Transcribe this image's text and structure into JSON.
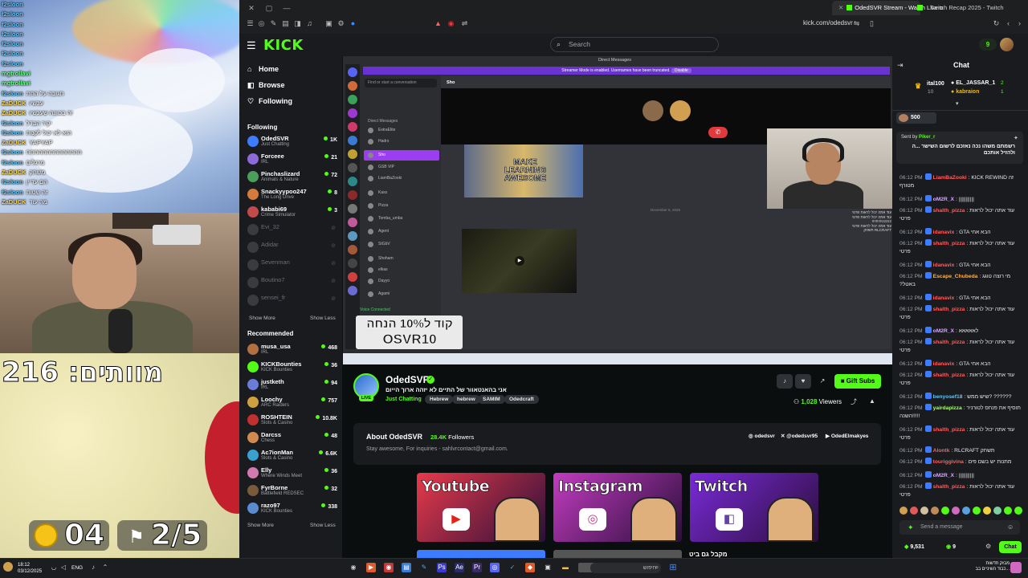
{
  "browser": {
    "tabs": [
      {
        "label": "OdedSVR Stream - Watch Live o"
      },
      {
        "label": "Twitch Recap 2025 - Twitch"
      }
    ],
    "url": "kick.com/odedsvr"
  },
  "overlay_chat": [
    {
      "user": "f2sloon",
      "color": "#59c8ff",
      "text": ""
    },
    {
      "user": "f2sloon",
      "color": "#59c8ff",
      "text": ""
    },
    {
      "user": "f2sloon",
      "color": "#59c8ff",
      "text": ""
    },
    {
      "user": "f2sloon",
      "color": "#59c8ff",
      "text": ""
    },
    {
      "user": "f2sloon",
      "color": "#59c8ff",
      "text": ""
    },
    {
      "user": "f2sloon",
      "color": "#59c8ff",
      "text": ""
    },
    {
      "user": "f2sloon",
      "color": "#59c8ff",
      "text": ""
    },
    {
      "user": "mgtrollavi",
      "color": "#6bff8a",
      "text": ""
    },
    {
      "user": "mgtrollavi",
      "color": "#6bff8a",
      "text": ""
    },
    {
      "user": "f2sloon",
      "color": "#59c8ff",
      "text": "תגובה על החת"
    },
    {
      "user": "ZaDUCK",
      "color": "#ffd84a",
      "text": "עכשיו"
    },
    {
      "user": "ZaDUCK",
      "color": "#ffd84a",
      "text": "זה בכוונה שעכשיו"
    },
    {
      "user": "f2sloon",
      "color": "#59c8ff",
      "text": "יקיר הבדל"
    },
    {
      "user": "f2sloon",
      "color": "#59c8ff",
      "text": "הוא לא יכול לקנות"
    },
    {
      "user": "ZaDUCK",
      "color": "#ffd84a",
      "text": "YAPYAP"
    },
    {
      "user": "f2sloon",
      "color": "#59c8ff",
      "text": "חחחחחחחחחחחחחח"
    },
    {
      "user": "f2sloon",
      "color": "#59c8ff",
      "text": "מרגלים"
    },
    {
      "user": "ZaDUCK",
      "color": "#ffd84a",
      "text": "משחק"
    },
    {
      "user": "f2sloon",
      "color": "#59c8ff",
      "text": "הם עדיין"
    },
    {
      "user": "f2sloon",
      "color": "#59c8ff",
      "text": "זה שטות"
    },
    {
      "user": "ZaDUCK",
      "color": "#ffd84a",
      "text": "מה עוד"
    }
  ],
  "game_overlay": {
    "deaths_label": "מוותים: 216",
    "coins": "04",
    "lap": "2/5"
  },
  "kick": {
    "search_placeholder": "Search",
    "points": "9",
    "nav": [
      {
        "label": "Home",
        "icon": "home-icon"
      },
      {
        "label": "Browse",
        "icon": "browse-icon"
      },
      {
        "label": "Following",
        "icon": "heart-icon"
      }
    ],
    "following_header": "Following",
    "following": [
      {
        "name": "OdedSVR",
        "sub": "Just Chatting",
        "count": "1K",
        "color": "#3d7bff",
        "live": true
      },
      {
        "name": "Forceee",
        "sub": "IRL",
        "count": "21",
        "color": "#8e6ad8",
        "live": true
      },
      {
        "name": "Pinchaslizard",
        "sub": "Animals & Nature",
        "count": "72",
        "color": "#4aa05a",
        "live": true
      },
      {
        "name": "Snackyypoo247",
        "sub": "The Long Drive",
        "count": "8",
        "color": "#d27b3a",
        "live": true
      },
      {
        "name": "kababi69",
        "sub": "Crime Simulator",
        "count": "3",
        "color": "#c24a4a",
        "live": true
      },
      {
        "name": "Evi_32",
        "sub": "",
        "count": "",
        "color": "#777",
        "live": false
      },
      {
        "name": "Adidar",
        "sub": "",
        "count": "",
        "color": "#777",
        "live": false
      },
      {
        "name": "Sevenman",
        "sub": "",
        "count": "",
        "color": "#777",
        "live": false
      },
      {
        "name": "Boutino7",
        "sub": "",
        "count": "",
        "color": "#777",
        "live": false
      },
      {
        "name": "sensei_fr",
        "sub": "",
        "count": "",
        "color": "#777",
        "live": false
      }
    ],
    "show_more": "Show More",
    "show_less": "Show Less",
    "recommended_header": "Recommended",
    "recommended": [
      {
        "name": "musa_usa",
        "sub": "IRL",
        "count": "468",
        "color": "#b07040"
      },
      {
        "name": "KICKBounties",
        "sub": "KICK Bounties",
        "count": "36",
        "color": "#53fc18"
      },
      {
        "name": "justketh",
        "sub": "IRL",
        "count": "94",
        "color": "#6a7bd8"
      },
      {
        "name": "Loochy",
        "sub": "ARC Raiders",
        "count": "757",
        "color": "#d0a040"
      },
      {
        "name": "ROSHTEIN",
        "sub": "Slots & Casino",
        "count": "10.8K",
        "color": "#c03030"
      },
      {
        "name": "Darcss",
        "sub": "Chess",
        "count": "48",
        "color": "#d08a50"
      },
      {
        "name": "Ac7ionMan",
        "sub": "Slots & Casino",
        "count": "6.6K",
        "color": "#3aa0d0"
      },
      {
        "name": "Elly",
        "sub": "Where Winds Meet",
        "count": "36",
        "color": "#d07ab0"
      },
      {
        "name": "FyrBorne",
        "sub": "Battlefield REDSEC",
        "count": "32",
        "color": "#7a5a3a"
      },
      {
        "name": "razo97",
        "sub": "KICK Bounties",
        "count": "338",
        "color": "#5a8ad0"
      }
    ],
    "stream": {
      "channel": "OdedSVR",
      "title": "אני בהאנטאוור של התיים לא יזהה ארוך הייום",
      "category": "Just Chatting",
      "tags": [
        "Hebrew",
        "hebrew",
        "SAMIM",
        "Odedcraft"
      ],
      "live_badge": "LIVE",
      "gift_label": "Gift Subs",
      "viewers": "1,028",
      "viewers_label": "Viewers"
    },
    "about": {
      "title": "About OdedSVR",
      "followers": "28.4K",
      "followers_label": "Followers",
      "description": "Stay awesome, For inquiries - sahlvrcontact@gmail.com.",
      "socials": [
        "odedsvr",
        "@odedsvr95",
        "OdedElmakyes"
      ]
    },
    "panels": [
      {
        "title": "Youtube",
        "bg": "#e83a4a",
        "icon": "youtube-icon",
        "glyph": "▶",
        "glyph_color": "#e62117"
      },
      {
        "title": "Instagram",
        "bg": "#c23cc0",
        "icon": "instagram-icon",
        "glyph": "◎",
        "glyph_color": "#c13584"
      },
      {
        "title": "Twitch",
        "bg": "#7a2ad8",
        "icon": "twitch-icon",
        "glyph": "◧",
        "glyph_color": "#6441a5"
      }
    ],
    "panel_caption": "מקבל גם ביט"
  },
  "discord": {
    "title": "Direct Messages",
    "banner": "Streamer Mode is enabled. Usernames have been truncated.",
    "banner_btn": "Disable",
    "find": "Find or start a conversation",
    "dm_header": "Direct Messages",
    "meme_text": "MAKE LEARNING AWESOME",
    "date_divider": "December 5, 2025",
    "call_user": "Sho",
    "voice_connected": "Voice Connected"
  },
  "promo": {
    "line1": "קוד ל10% הנחה",
    "line2": "OSVR10"
  },
  "chat": {
    "title": "Chat",
    "leaderboard": [
      {
        "name": "ital100",
        "num": "10"
      },
      {
        "name": "EL_JASSAR_1",
        "num": "2"
      },
      {
        "name": "kabraion",
        "num": "1"
      }
    ],
    "pinned_amount": "500",
    "sent_by": "Sent by",
    "sent_user": "Piker_r",
    "pinned_text": "רשמתם משהו נכה נאזכם לרשום השישר ...ה ולהזיל אותכם",
    "messages": [
      {
        "time": "06:12 PM",
        "user": "LiamBaZooki",
        "color": "#ff5f5f",
        "text": "KICK REWIND זה מטורף"
      },
      {
        "time": "06:12 PM",
        "user": "oM2R_X",
        "color": "#d7a8ff",
        "text": "|||||||||||"
      },
      {
        "time": "06:12 PM",
        "user": "shalth_pizza",
        "color": "#ff5f5f",
        "text": "עוד אתה יכול לראות פרטי"
      },
      {
        "time": "06:12 PM",
        "user": "idanavix",
        "color": "#ff5f5f",
        "text": "GTA הבא אחי"
      },
      {
        "time": "06:12 PM",
        "user": "shalth_pizza",
        "color": "#ff5f5f",
        "text": "עוד אתה יכול לראות פרטי"
      },
      {
        "time": "06:12 PM",
        "user": "idanavix",
        "color": "#ff5f5f",
        "text": "GTA הבא אחי"
      },
      {
        "time": "06:12 PM",
        "user": "Escape_Chubeda",
        "color": "#ffb04a",
        "text": "מי רוצה טוגג באטל?"
      },
      {
        "time": "06:12 PM",
        "user": "idanavix",
        "color": "#ff5f5f",
        "text": "GTA הבא אחי"
      },
      {
        "time": "06:12 PM",
        "user": "shalth_pizza",
        "color": "#ff5f5f",
        "text": "עוד אתה יכול לראות פרטי"
      },
      {
        "time": "06:12 PM",
        "user": "oM2R_X",
        "color": "#d7a8ff",
        "text": "לאאאאא"
      },
      {
        "time": "06:12 PM",
        "user": "shalth_pizza",
        "color": "#ff5f5f",
        "text": "עוד אתה יכול לראות פרטי"
      },
      {
        "time": "06:12 PM",
        "user": "idanavix",
        "color": "#ff5f5f",
        "text": "GTA הבא אחי"
      },
      {
        "time": "06:12 PM",
        "user": "shalth_pizza",
        "color": "#ff5f5f",
        "text": "עוד אתה יכול לראות פרטי"
      },
      {
        "time": "06:12 PM",
        "user": "benyosef18",
        "color": "#59c8ff",
        "text": "?????? ?שיש ממש"
      },
      {
        "time": "06:12 PM",
        "user": "yairdapizza",
        "color": "#a6ff6b",
        "text": "תוסיף את פנחס לטורניר !!!!!השנה"
      },
      {
        "time": "06:12 PM",
        "user": "shalth_pizza",
        "color": "#ff5f5f",
        "text": "עוד אתה יכול לראות פרטי"
      },
      {
        "time": "06:12 PM",
        "user": "Alontk",
        "color": "#ff5f5f",
        "text": "RLCRAFT תשחק"
      },
      {
        "time": "06:12 PM",
        "user": "touriggivina",
        "color": "#ff5f5f",
        "text": "מתנות יש בשם פים"
      },
      {
        "time": "06:12 PM",
        "user": "oM2R_X",
        "color": "#d7a8ff",
        "text": "|||||||||||"
      },
      {
        "time": "06:12 PM",
        "user": "shalth_pizza",
        "color": "#ff5f5f",
        "text": "עוד אתה יכול לראות פרטי"
      }
    ],
    "send_placeholder": "Send a message",
    "points": "9,531",
    "count2": "9",
    "chat_button": "Chat"
  },
  "taskbar": {
    "time": "18:12",
    "date": "03/12/2025",
    "lang": "ENG",
    "search": "חיפוש",
    "news_line1": "מבזק חדשות",
    "news_line2": "כבוד השיניים בב..."
  }
}
